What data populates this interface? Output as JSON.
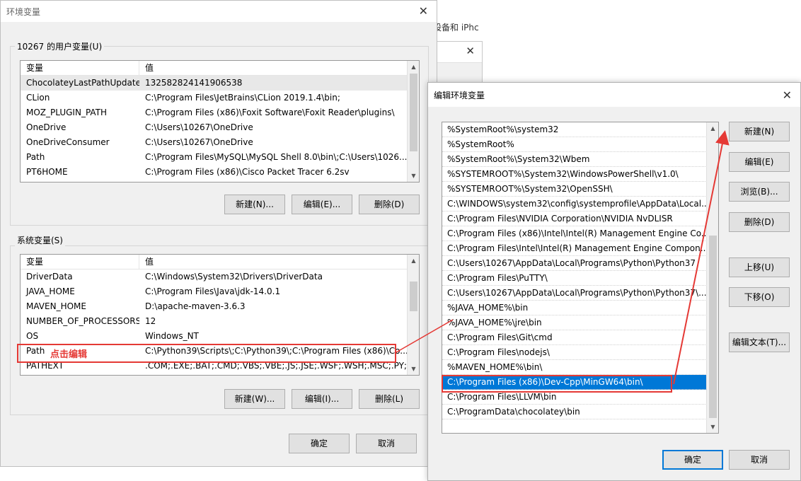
{
  "background": {
    "text": "设备和 iPhc",
    "close_glyph": "✕"
  },
  "main_window": {
    "title": "环境变量",
    "close_glyph": "✕",
    "user_vars": {
      "group_label": "10267 的用户变量(U)",
      "headers": [
        "变量",
        "值"
      ],
      "rows": [
        {
          "name": "ChocolateyLastPathUpdate",
          "value": "132582824141906538"
        },
        {
          "name": "CLion",
          "value": "C:\\Program Files\\JetBrains\\CLion 2019.1.4\\bin;"
        },
        {
          "name": "MOZ_PLUGIN_PATH",
          "value": "C:\\Program Files (x86)\\Foxit Software\\Foxit Reader\\plugins\\"
        },
        {
          "name": "OneDrive",
          "value": "C:\\Users\\10267\\OneDrive"
        },
        {
          "name": "OneDriveConsumer",
          "value": "C:\\Users\\10267\\OneDrive"
        },
        {
          "name": "Path",
          "value": "C:\\Program Files\\MySQL\\MySQL Shell 8.0\\bin\\;C:\\Users\\1026..."
        },
        {
          "name": "PT6HOME",
          "value": "C:\\Program Files (x86)\\Cisco Packet Tracer 6.2sv"
        }
      ],
      "buttons": {
        "new": "新建(N)...",
        "edit": "编辑(E)...",
        "delete": "删除(D)"
      }
    },
    "system_vars": {
      "group_label": "系统变量(S)",
      "headers": [
        "变量",
        "值"
      ],
      "rows": [
        {
          "name": "DriverData",
          "value": "C:\\Windows\\System32\\Drivers\\DriverData"
        },
        {
          "name": "JAVA_HOME",
          "value": "C:\\Program Files\\Java\\jdk-14.0.1"
        },
        {
          "name": "MAVEN_HOME",
          "value": "D:\\apache-maven-3.6.3"
        },
        {
          "name": "NUMBER_OF_PROCESSORS",
          "value": "12"
        },
        {
          "name": "OS",
          "value": "Windows_NT"
        },
        {
          "name": "Path",
          "value": "C:\\Python39\\Scripts\\;C:\\Python39\\;C:\\Program Files (x86)\\Co..."
        },
        {
          "name": "PATHEXT",
          "value": ".COM;.EXE;.BAT;.CMD;.VBS;.VBE;.JS;.JSE;.WSF;.WSH;.MSC;.PY;.P..."
        }
      ],
      "annotation": "点击编辑",
      "buttons": {
        "new": "新建(W)...",
        "edit": "编辑(I)...",
        "delete": "删除(L)"
      }
    },
    "ok": "确定",
    "cancel": "取消"
  },
  "edit_dialog": {
    "title": "编辑环境变量",
    "close_glyph": "✕",
    "paths": [
      "%SystemRoot%\\system32",
      "%SystemRoot%",
      "%SystemRoot%\\System32\\Wbem",
      "%SYSTEMROOT%\\System32\\WindowsPowerShell\\v1.0\\",
      "%SYSTEMROOT%\\System32\\OpenSSH\\",
      "C:\\WINDOWS\\system32\\config\\systemprofile\\AppData\\Local...",
      "C:\\Program Files\\NVIDIA Corporation\\NVIDIA NvDLISR",
      "C:\\Program Files (x86)\\Intel\\Intel(R) Management Engine Co...",
      "C:\\Program Files\\Intel\\Intel(R) Management Engine Compon...",
      "C:\\Users\\10267\\AppData\\Local\\Programs\\Python\\Python37",
      "C:\\Program Files\\PuTTY\\",
      "C:\\Users\\10267\\AppData\\Local\\Programs\\Python\\Python37\\...",
      "%JAVA_HOME%\\bin",
      "%JAVA_HOME%\\jre\\bin",
      "C:\\Program Files\\Git\\cmd",
      "C:\\Program Files\\nodejs\\",
      "%MAVEN_HOME%\\bin\\",
      "C:\\Program Files (x86)\\Dev-Cpp\\MinGW64\\bin\\",
      "C:\\Program Files\\LLVM\\bin",
      "C:\\ProgramData\\chocolatey\\bin"
    ],
    "selected_index": 17,
    "buttons": {
      "new": "新建(N)",
      "edit": "编辑(E)",
      "browse": "浏览(B)...",
      "delete": "删除(D)",
      "up": "上移(U)",
      "down": "下移(O)",
      "edit_text": "编辑文本(T)..."
    },
    "ok": "确定",
    "cancel": "取消"
  },
  "colors": {
    "annotation": "#e53935",
    "selection": "#0078d7"
  }
}
